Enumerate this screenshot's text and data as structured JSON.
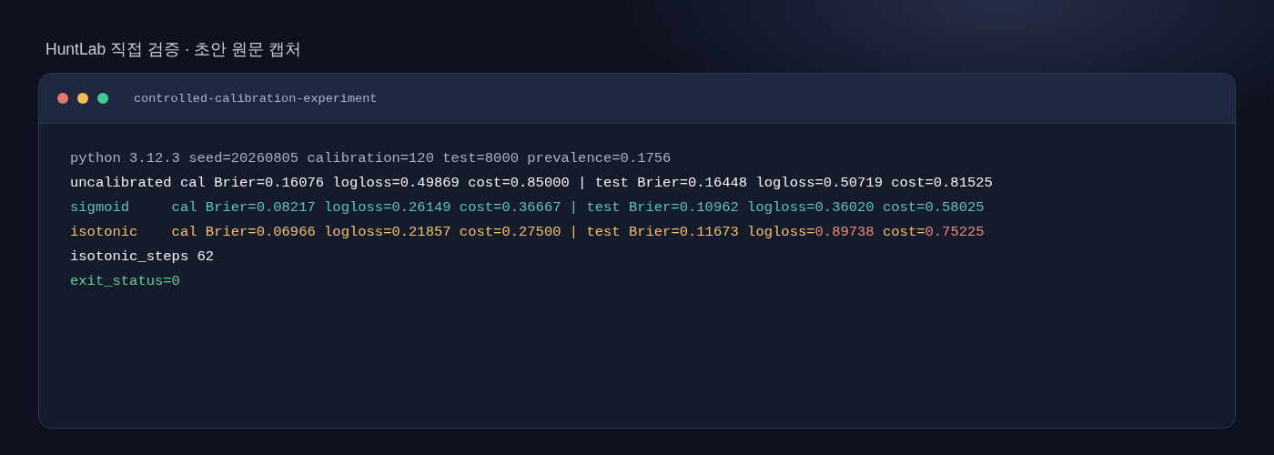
{
  "page_title": "HuntLab 직접 검증 · 초안 원문 캡처",
  "window": {
    "title": "controlled-calibration-experiment",
    "controls": [
      {
        "color": "#e8766b"
      },
      {
        "color": "#f4c054"
      },
      {
        "color": "#3fc996"
      }
    ]
  },
  "terminal": {
    "lines": [
      {
        "segments": [
          {
            "text": "python 3.12.3 seed=20260805 calibration=120 test=8000 prevalence=0.1756",
            "color": "#a9b1c4"
          }
        ]
      },
      {
        "segments": [
          {
            "text": "uncalibrated cal Brier=0.16076 logloss=0.49869 cost=0.85000 | test Brier=0.16448 logloss=0.50719 cost=0.81525",
            "color": "#f2f4f8"
          }
        ]
      },
      {
        "segments": [
          {
            "text": "sigmoid     cal Brier=0.08217 logloss=0.26149 cost=0.36667 | test Brier=0.10962 logloss=0.36020 cost=0.58025",
            "color": "#5cc4bb"
          }
        ]
      },
      {
        "segments": [
          {
            "text": "isotonic    cal Brier=0.06966 logloss=0.21857 cost=0.27500 | test Brier=0.11673 logloss=",
            "color": "#f2c06a"
          },
          {
            "text": "0.89738",
            "color": "#ee8a7c"
          },
          {
            "text": " cost=",
            "color": "#f2c06a"
          },
          {
            "text": "0.75225",
            "color": "#ee8a7c"
          }
        ]
      },
      {
        "segments": [
          {
            "text": "isotonic_steps 62",
            "color": "#f2f4f8"
          }
        ]
      },
      {
        "segments": [
          {
            "text": "exit_status=0",
            "color": "#63cf96"
          }
        ]
      }
    ]
  }
}
